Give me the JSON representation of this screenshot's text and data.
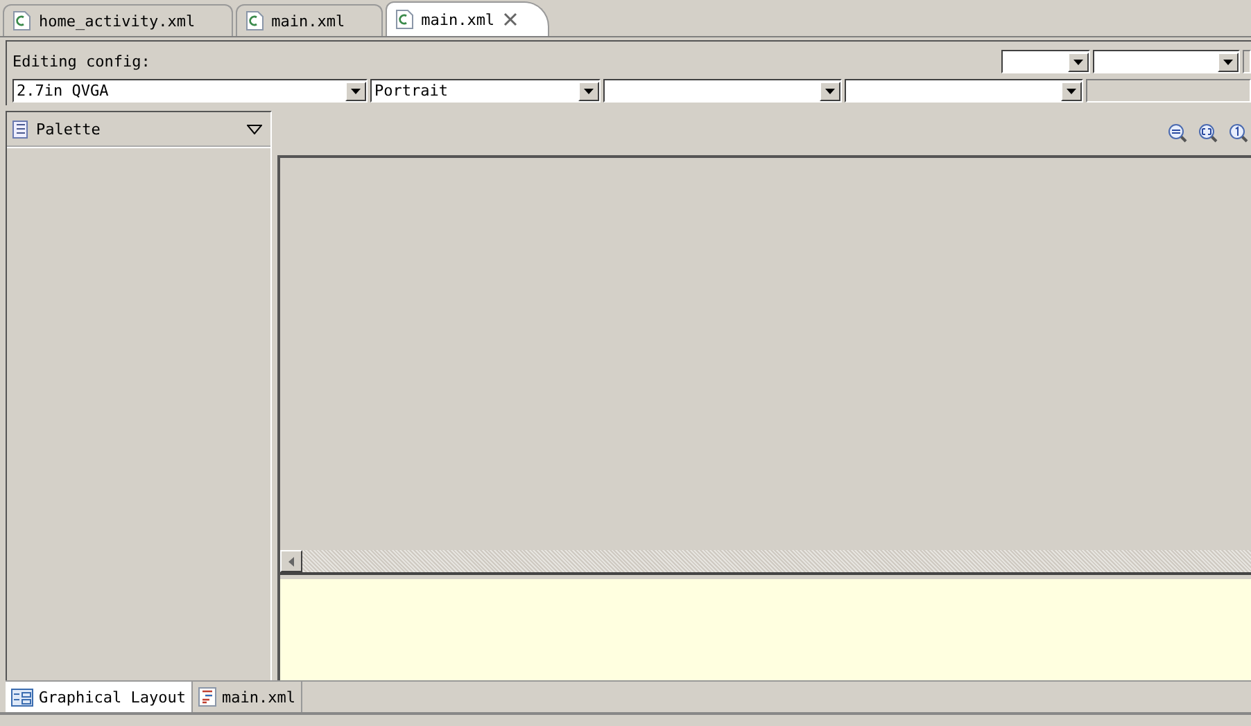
{
  "editor_tabs": [
    {
      "label": "home_activity.xml",
      "selected": false,
      "closable": false
    },
    {
      "label": "main.xml",
      "selected": false,
      "closable": false
    },
    {
      "label": "main.xml",
      "selected": true,
      "closable": true
    }
  ],
  "config": {
    "label": "Editing config:",
    "device": "2.7in QVGA",
    "orientation": "Portrait"
  },
  "palette": {
    "title": "Palette"
  },
  "bottom_tabs": [
    {
      "label": "Graphical Layout",
      "selected": true,
      "kind": "layout"
    },
    {
      "label": "main.xml",
      "selected": false,
      "kind": "xml"
    }
  ]
}
